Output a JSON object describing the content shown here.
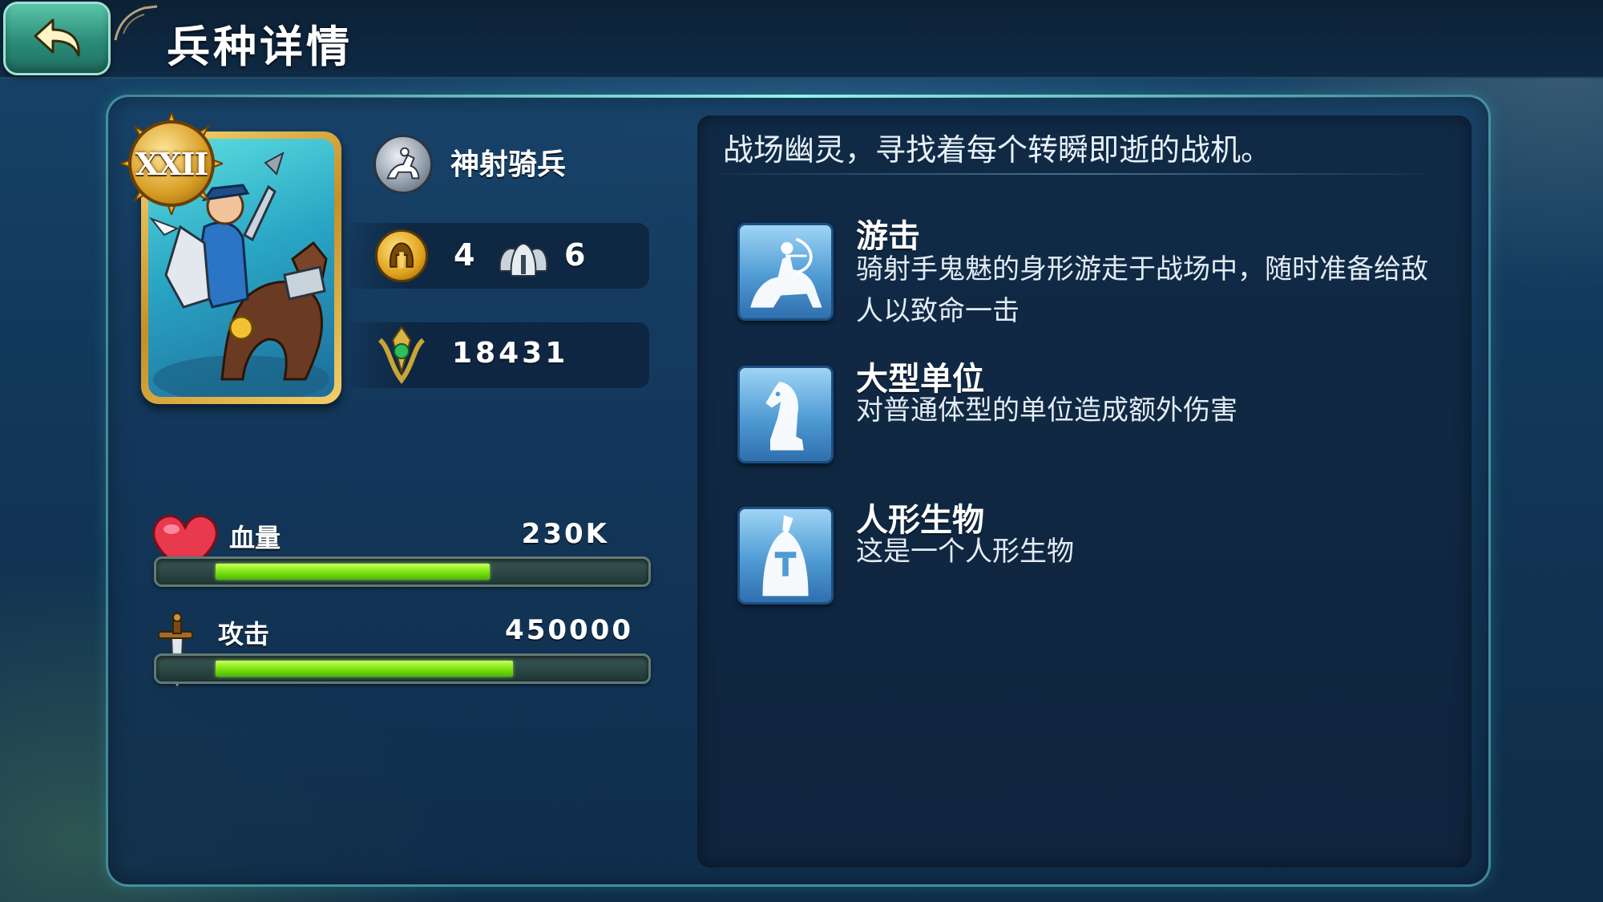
{
  "header": {
    "title": "兵种详情",
    "back_icon": "back-arrow-icon"
  },
  "unit": {
    "name": "神射骑兵",
    "rank": "XXII",
    "type_icon": "mounted-archer-icon",
    "tier_icon": "helmet-icon",
    "tier_value": "4",
    "squad_icon": "squad-helmets-icon",
    "squad_value": "6",
    "power_icon": "power-crest-icon",
    "power_value": "18431"
  },
  "stats": {
    "hp": {
      "label": "血量",
      "value": "230K",
      "fill": 0.645,
      "icon": "heart-icon"
    },
    "attack": {
      "label": "攻击",
      "value": "450000",
      "fill": 0.7,
      "icon": "sword-icon"
    }
  },
  "description": {
    "flavor": "战场幽灵，寻找着每个转瞬即逝的战机。",
    "traits": [
      {
        "title": "游击",
        "desc": "骑射手鬼魅的身形游走于战场中，随时准备给敌人以致命一击",
        "icon": "horse-archer-icon"
      },
      {
        "title": "大型单位",
        "desc": "对普通体型的单位造成额外伤害",
        "icon": "chess-knight-icon"
      },
      {
        "title": "人形生物",
        "desc": "这是一个人形生物",
        "icon": "knight-helmet-icon"
      }
    ]
  },
  "colors": {
    "bar_fill": "#78e20d",
    "panel_border": "#6ed2d2",
    "card_gold": "#f2cf6a"
  }
}
